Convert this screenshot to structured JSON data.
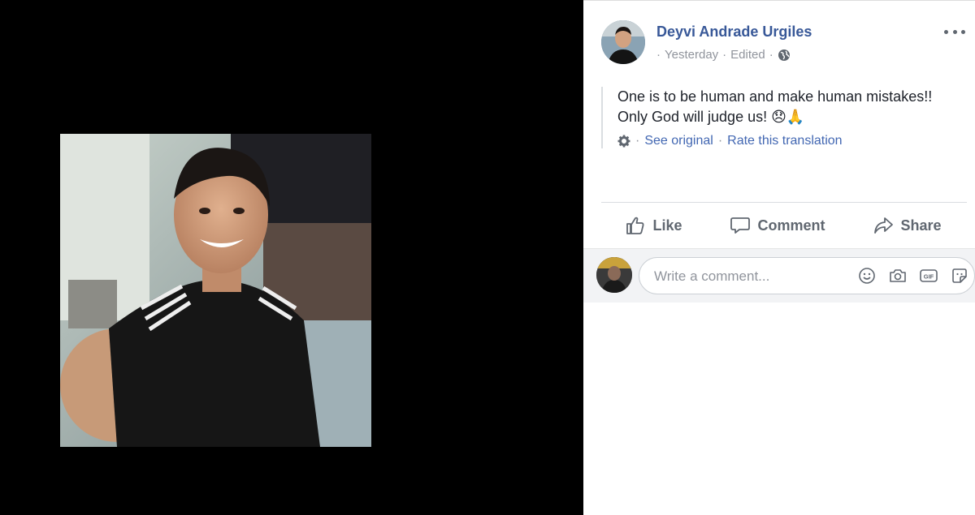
{
  "post": {
    "author": "Deyvi Andrade Urgiles",
    "time": "Yesterday",
    "edited": "Edited",
    "meta_separator": "·",
    "text_line1": "One is to be human and make human mistakes!!",
    "text_line2": "Only God will judge us! 😞🙏",
    "see_original": "See original",
    "rate_translation": "Rate this translation"
  },
  "actions": {
    "like": "Like",
    "comment": "Comment",
    "share": "Share"
  },
  "comment_box": {
    "placeholder": "Write a comment..."
  },
  "colors": {
    "link": "#385898",
    "accent": "#4267b2",
    "muted": "#90949c"
  }
}
